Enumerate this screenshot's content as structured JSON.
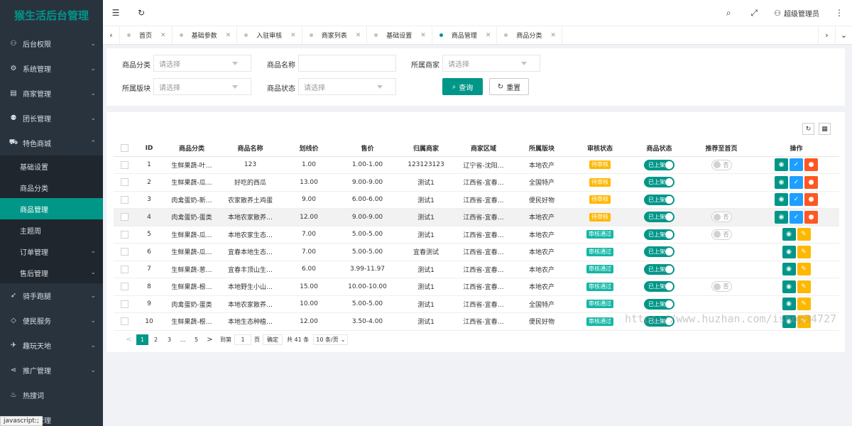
{
  "app": {
    "title": "猴生活后台管理"
  },
  "sidebar": {
    "items": [
      {
        "label": "后台权限",
        "icon": "user-icon",
        "arrow": "⌄"
      },
      {
        "label": "系统管理",
        "icon": "gear-icon",
        "arrow": "⌄"
      },
      {
        "label": "商家管理",
        "icon": "store-icon",
        "arrow": "⌄"
      },
      {
        "label": "团长管理",
        "icon": "people-icon",
        "arrow": "⌄"
      },
      {
        "label": "特色商城",
        "icon": "cart-icon",
        "arrow": "⌃"
      }
    ],
    "submenu": [
      {
        "label": "基础设置"
      },
      {
        "label": "商品分类"
      },
      {
        "label": "商品管理"
      },
      {
        "label": "主题周"
      },
      {
        "label": "订单管理",
        "arrow": "⌄"
      },
      {
        "label": "售后管理",
        "arrow": "⌄"
      }
    ],
    "items_after": [
      {
        "label": "骑手跑腿",
        "icon": "rider-icon",
        "arrow": "⌄"
      },
      {
        "label": "便民服务",
        "icon": "diamond-icon",
        "arrow": "⌄"
      },
      {
        "label": "趣玩天地",
        "icon": "game-icon",
        "arrow": "⌄"
      },
      {
        "label": "推广管理",
        "icon": "share-icon",
        "arrow": "⌄"
      },
      {
        "label": "热搜词",
        "icon": "fire-icon",
        "arrow": ""
      },
      {
        "label": "…券管理",
        "icon": "coupon-icon",
        "arrow": ""
      }
    ],
    "status_tip": "javascript:;"
  },
  "header": {
    "user_label": "超级管理员"
  },
  "tabs": [
    {
      "label": "首页",
      "active": false
    },
    {
      "label": "基础参数",
      "active": false
    },
    {
      "label": "入驻审核",
      "active": false
    },
    {
      "label": "商家列表",
      "active": false
    },
    {
      "label": "基础设置",
      "active": false
    },
    {
      "label": "商品管理",
      "active": true
    },
    {
      "label": "商品分类",
      "active": false
    }
  ],
  "filters": {
    "category_label": "商品分类",
    "category_placeholder": "请选择",
    "name_label": "商品名称",
    "name_value": "",
    "merchant_label": "所属商家",
    "merchant_placeholder": "请选择",
    "section_label": "所属版块",
    "section_placeholder": "请选择",
    "status_label": "商品状态",
    "status_placeholder": "请选择",
    "query_label": "查询",
    "reset_label": "重置"
  },
  "table": {
    "headers": [
      "",
      "ID",
      "商品分类",
      "商品名称",
      "划线价",
      "售价",
      "归属商家",
      "商家区域",
      "所属版块",
      "审核状态",
      "商品状态",
      "推荐至首页",
      "操作"
    ],
    "rows": [
      {
        "id": "1",
        "category": "生鲜果蔬-叶…",
        "name": "123",
        "list_price": "1.00",
        "price": "1.00-1.00",
        "merchant": "123123123",
        "region": "辽宁省-沈阳…",
        "section": "本地农产",
        "audit": "待审核",
        "audit_type": "pending",
        "status": "已上架",
        "recommend": "否",
        "actions": "audit"
      },
      {
        "id": "2",
        "category": "生鲜果蔬-瓜…",
        "name": "好吃的西瓜",
        "list_price": "13.00",
        "price": "9.00-9.00",
        "merchant": "测试1",
        "region": "江西省-宜春…",
        "section": "全国特产",
        "audit": "待审核",
        "audit_type": "pending",
        "status": "已上架",
        "recommend": "",
        "actions": "audit"
      },
      {
        "id": "3",
        "category": "肉禽蛋奶-新…",
        "name": "农家散养土鸡蛋",
        "list_price": "9.00",
        "price": "6.00-6.00",
        "merchant": "测试1",
        "region": "江西省-宜春…",
        "section": "便民好物",
        "audit": "待审核",
        "audit_type": "pending",
        "status": "已上架",
        "recommend": "",
        "actions": "audit"
      },
      {
        "id": "4",
        "category": "肉禽蛋奶-蛋类",
        "name": "本地农家散养…",
        "list_price": "12.00",
        "price": "9.00-9.00",
        "merchant": "测试1",
        "region": "江西省-宜春…",
        "section": "本地农产",
        "audit": "待审核",
        "audit_type": "pending",
        "status": "已上架",
        "recommend": "否",
        "actions": "audit"
      },
      {
        "id": "5",
        "category": "生鲜果蔬-瓜…",
        "name": "本地农家生态…",
        "list_price": "7.00",
        "price": "5.00-5.00",
        "merchant": "测试1",
        "region": "江西省-宜春…",
        "section": "本地农产",
        "audit": "审核通过",
        "audit_type": "approved",
        "status": "已上架",
        "recommend": "否",
        "actions": "edit"
      },
      {
        "id": "6",
        "category": "生鲜果蔬-瓜…",
        "name": "宜春本地生态…",
        "list_price": "7.00",
        "price": "5.00-5.00",
        "merchant": "宜春测试",
        "region": "江西省-宜春…",
        "section": "本地农产",
        "audit": "审核通过",
        "audit_type": "approved",
        "status": "已上架",
        "recommend": "",
        "actions": "edit"
      },
      {
        "id": "7",
        "category": "生鲜果蔬-葱…",
        "name": "宜春丰顶山生…",
        "list_price": "6.00",
        "price": "3.99-11.97",
        "merchant": "测试1",
        "region": "江西省-宜春…",
        "section": "本地农产",
        "audit": "审核通过",
        "audit_type": "approved",
        "status": "已上架",
        "recommend": "",
        "actions": "edit"
      },
      {
        "id": "8",
        "category": "生鲜果蔬-根…",
        "name": "本地野生小山…",
        "list_price": "15.00",
        "price": "10.00-10.00",
        "merchant": "测试1",
        "region": "江西省-宜春…",
        "section": "本地农产",
        "audit": "审核通过",
        "audit_type": "approved",
        "status": "已上架",
        "recommend": "否",
        "actions": "edit"
      },
      {
        "id": "9",
        "category": "肉禽蛋奶-蛋类",
        "name": "本地农家散养…",
        "list_price": "10.00",
        "price": "5.00-5.00",
        "merchant": "测试1",
        "region": "江西省-宜春…",
        "section": "全国特产",
        "audit": "审核通过",
        "audit_type": "approved",
        "status": "已上架",
        "recommend": "",
        "actions": "edit"
      },
      {
        "id": "10",
        "category": "生鲜果蔬-根…",
        "name": "本地生态种植…",
        "list_price": "12.00",
        "price": "3.50-4.00",
        "merchant": "测试1",
        "region": "江西省-宜春…",
        "section": "便民好物",
        "audit": "审核通过",
        "audit_type": "approved",
        "status": "已上架",
        "recommend": "",
        "actions": "edit"
      }
    ]
  },
  "pagination": {
    "prev": "<",
    "pages": [
      "1",
      "2",
      "3",
      "…",
      "5"
    ],
    "current": "1",
    "next": ">",
    "goto_prefix": "到第",
    "goto_value": "1",
    "goto_suffix": "页",
    "confirm": "确定",
    "total": "共 41 条",
    "page_size": "10 条/页"
  },
  "watermark": "https://www.huzhan.com/ishop34727",
  "colors": {
    "accent": "#009688",
    "sidebar_bg": "#28333e",
    "pending": "#ffb800",
    "approved": "#16b7a6",
    "approve_btn": "#1e9fff",
    "reject_btn": "#ff5722"
  }
}
